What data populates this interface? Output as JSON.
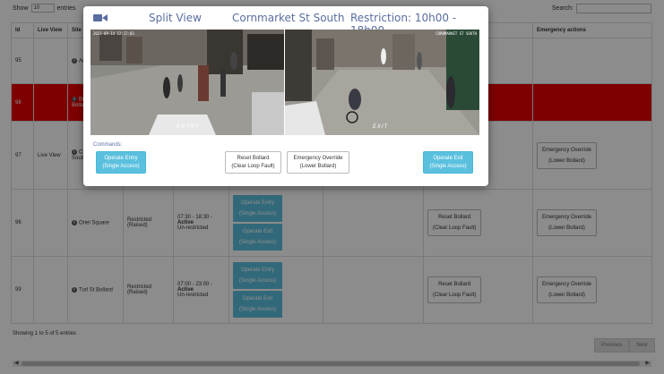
{
  "topbar": {
    "show_label": "Show",
    "show_value": "10",
    "entries_label": "entries",
    "search_label": "Search:"
  },
  "table": {
    "headers": [
      "Id",
      "Live View",
      "Site",
      "",
      "",
      "",
      "",
      "",
      "Emergency actions"
    ],
    "rows": [
      {
        "id": "95",
        "live": "",
        "site": "Ar",
        "state": "",
        "schedule": "",
        "mode": ""
      },
      {
        "id": "98",
        "live": "",
        "site": "Bi",
        "site_sub": "Bollard",
        "state": "",
        "schedule": "",
        "mode": ""
      },
      {
        "id": "97",
        "live": "Live View",
        "site": "Cu",
        "site_sub": "South",
        "state": "",
        "schedule": "",
        "mode": ""
      },
      {
        "id": "96",
        "live": "",
        "site": "Oriel Square",
        "state": "Restricted (Raised)",
        "schedule": "07:30 - 18:30 -",
        "status": "Active",
        "mode": "Un-restricted"
      },
      {
        "id": "99",
        "live": "",
        "site": "Turl St Bollard",
        "state": "Restricted (Raised)",
        "schedule": "07:00 - 23:00 -",
        "status": "Active",
        "mode": "Un-restricted"
      }
    ],
    "operate_entry": "Operate Entry",
    "operate_exit": "Operate Exit",
    "single_access": "(Single Access)",
    "reset_bollard": "Reset Bollard",
    "clear_loop": "(Clear Loop Fault)",
    "emergency_override": "Emergency Override",
    "lower_bollard": "(Lower Bollard)"
  },
  "footer": {
    "info": "Showing 1 to 5 of 5 entries",
    "previous": "Previous",
    "next": "Next"
  },
  "modal": {
    "title_view": "Split View",
    "title_site": "Cornmarket St South",
    "title_restriction": "Restriction: 10h00 - 18h00",
    "feed_left_label": "ENTRY",
    "feed_right_label": "EXIT",
    "feed_left_ts": "2021-09-14 12:17:03",
    "feed_right_ts": "CORNMARKET ST SOUTH",
    "commands_label": "Commands:",
    "btn_entry_l1": "Operate Entry",
    "btn_entry_l2": "(Single Access)",
    "btn_reset_l1": "Reset Bollard",
    "btn_reset_l2": "(Clear Loop Fault)",
    "btn_override_l1": "Emergency Override",
    "btn_override_l2": "(Lower Bollard)",
    "btn_exit_l1": "Operate Exit",
    "btn_exit_l2": "(Single Access)"
  },
  "colors": {
    "danger_row": "#e60000",
    "info_button": "#5bc0de",
    "title_blue": "#5a6ea0"
  },
  "icons": {
    "camera": "video-camera-icon",
    "info": "info-circle-icon"
  }
}
